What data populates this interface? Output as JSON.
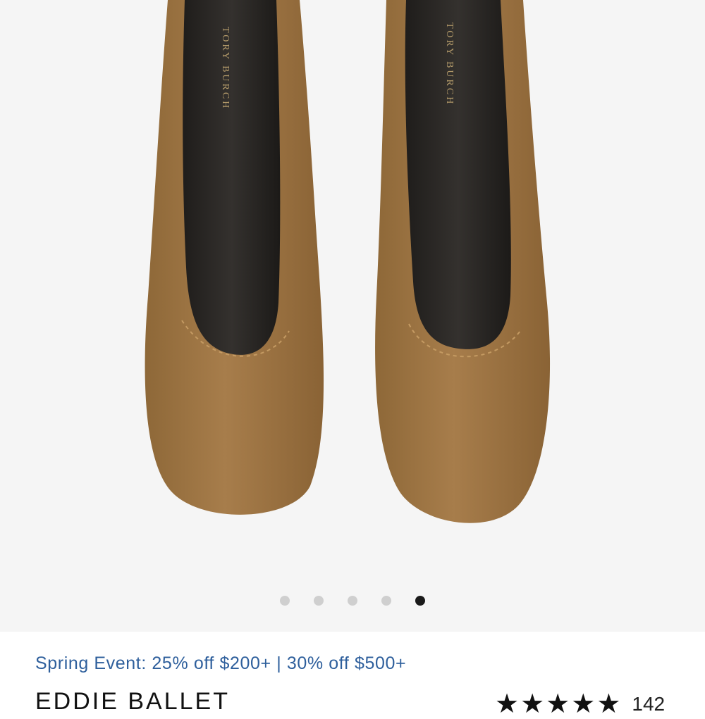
{
  "gallery": {
    "image_alt": "Tory Burch suede ballet flats",
    "insole_brand": "TORY BURCH",
    "slide_count": 5,
    "active_slide": 5
  },
  "product": {
    "promo": "Spring Event: 25% off $200+ | 30% off $500+",
    "title": "EDDIE BALLET",
    "rating_stars": 5,
    "review_count": "142"
  },
  "colors": {
    "promo": "#2e5f9c",
    "suede": "#9f7745",
    "insole": "#2b2927",
    "active_dot": "#1a1a1a",
    "inactive_dot": "#cfcfcf"
  }
}
